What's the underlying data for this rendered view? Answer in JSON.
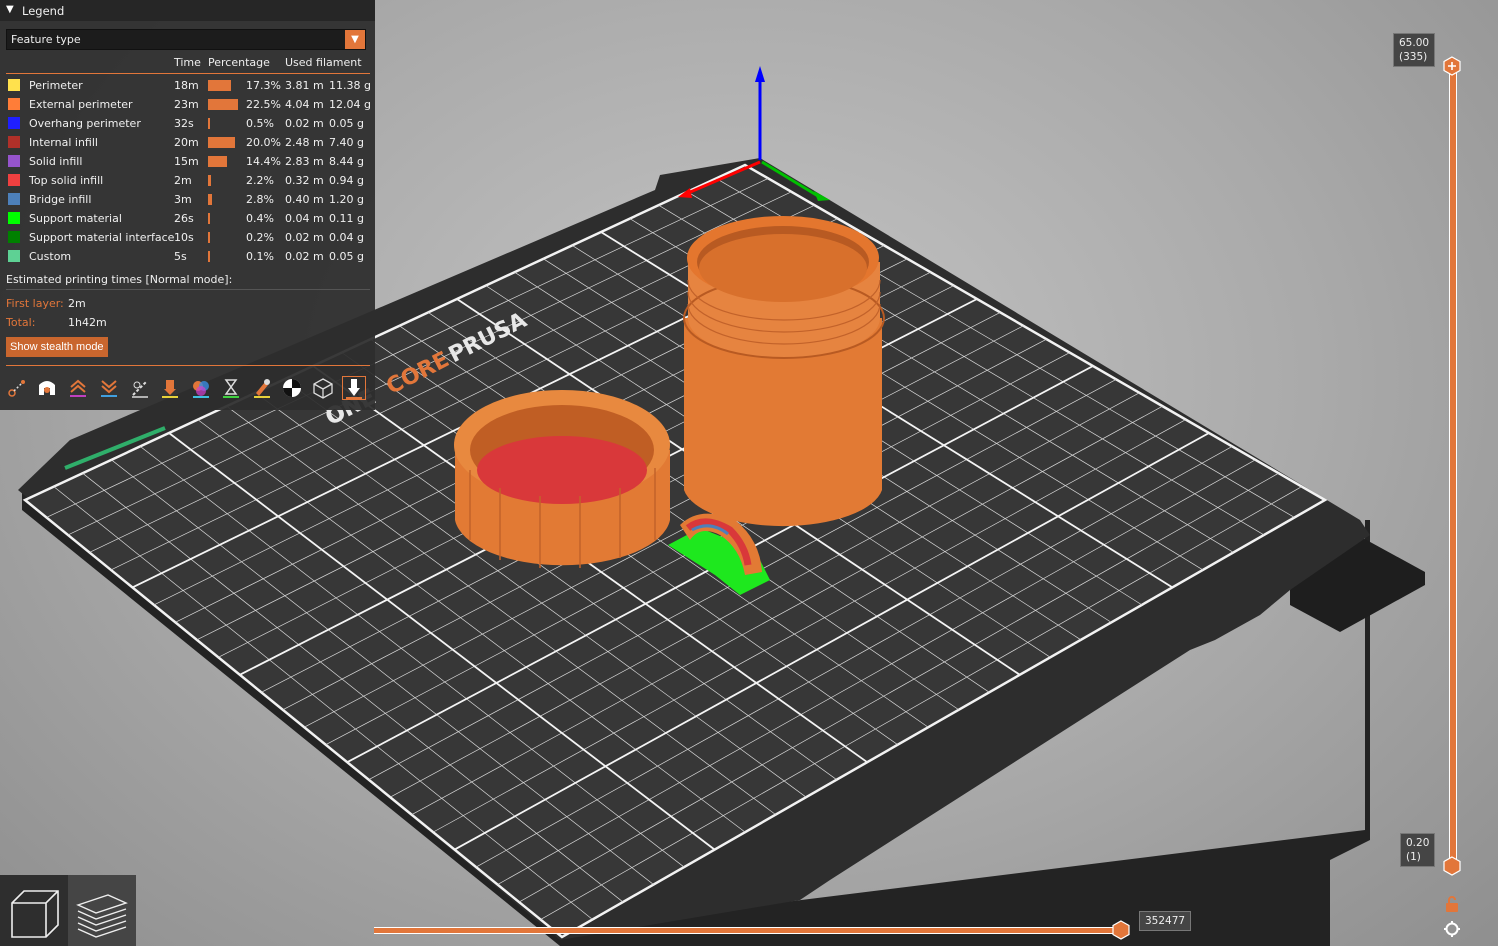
{
  "legend": {
    "title": "Legend",
    "view_type": "Feature type",
    "headers": {
      "time": "Time",
      "percentage": "Percentage",
      "filament": "Used filament"
    },
    "rows": [
      {
        "name": "Perimeter",
        "color": "#ffe14d",
        "time": "18m",
        "pct": "17.3%",
        "pct_value": 17.3,
        "length": "3.81 m",
        "weight": "11.38 g"
      },
      {
        "name": "External perimeter",
        "color": "#ff7d38",
        "time": "23m",
        "pct": "22.5%",
        "pct_value": 22.5,
        "length": "4.04 m",
        "weight": "12.04 g"
      },
      {
        "name": "Overhang perimeter",
        "color": "#1f1fff",
        "time": "32s",
        "pct": "0.5%",
        "pct_value": 0.5,
        "length": "0.02 m",
        "weight": "0.05 g"
      },
      {
        "name": "Internal infill",
        "color": "#b03029",
        "time": "20m",
        "pct": "20.0%",
        "pct_value": 20.0,
        "length": "2.48 m",
        "weight": "7.40 g"
      },
      {
        "name": "Solid infill",
        "color": "#9654cc",
        "time": "15m",
        "pct": "14.4%",
        "pct_value": 14.4,
        "length": "2.83 m",
        "weight": "8.44 g"
      },
      {
        "name": "Top solid infill",
        "color": "#f04040",
        "time": "2m",
        "pct": "2.2%",
        "pct_value": 2.2,
        "length": "0.32 m",
        "weight": "0.94 g"
      },
      {
        "name": "Bridge infill",
        "color": "#4d80ba",
        "time": "3m",
        "pct": "2.8%",
        "pct_value": 2.8,
        "length": "0.40 m",
        "weight": "1.20 g"
      },
      {
        "name": "Support material",
        "color": "#00ff00",
        "time": "26s",
        "pct": "0.4%",
        "pct_value": 0.4,
        "length": "0.04 m",
        "weight": "0.11 g"
      },
      {
        "name": "Support material interface",
        "color": "#008000",
        "time": "10s",
        "pct": "0.2%",
        "pct_value": 0.2,
        "length": "0.02 m",
        "weight": "0.04 g"
      },
      {
        "name": "Custom",
        "color": "#5ed194",
        "time": "5s",
        "pct": "0.1%",
        "pct_value": 0.1,
        "length": "0.02 m",
        "weight": "0.05 g"
      }
    ],
    "estimated_label": "Estimated printing times [Normal mode]:",
    "first_layer_label": "First layer:",
    "first_layer_value": "2m",
    "total_label": "Total:",
    "total_value": "1h42m",
    "stealth_button": "Show stealth mode",
    "toolbar_icons": [
      "travel-icon",
      "wipe-icon",
      "retractions-icon",
      "deretractions-icon",
      "seams-icon",
      "tool-changes-icon",
      "color-changes-icon",
      "pause-prints-icon",
      "custom-gcodes-icon",
      "center-of-gravity-icon",
      "shells-icon",
      "tool-marker-icon"
    ]
  },
  "bed_logo": {
    "brand": "PRUSA",
    "model_a": "CORE",
    "model_b": "ONE"
  },
  "vertical_slider": {
    "top_height": "65.00",
    "top_layer": "(335)",
    "bottom_height": "0.20",
    "bottom_layer": "(1)"
  },
  "horizontal_slider": {
    "value": "352477"
  },
  "view_buttons": [
    "3d-view-icon",
    "preview-view-icon"
  ],
  "colors": {
    "accent": "#e2763a",
    "panel": "#2e2e2e"
  }
}
